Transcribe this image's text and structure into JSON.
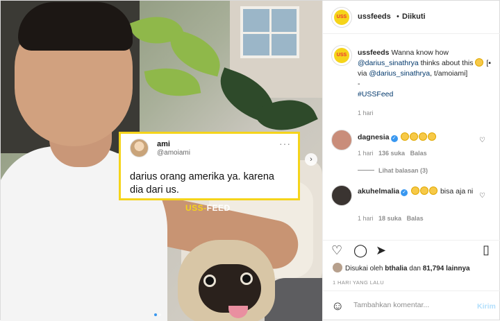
{
  "post": {
    "tweet": {
      "name": "ami",
      "handle": "@amoiami",
      "text": "darius orang amerika ya. karena dia dari us."
    },
    "watermark": {
      "part1": "USS-",
      "part2": "FEED"
    }
  },
  "header": {
    "username": "ussfeeds",
    "separator": "•",
    "follow_status": "Diikuti"
  },
  "caption": {
    "username": "ussfeeds",
    "text_1": "Wanna know how",
    "mention_1": "@darius_sinathrya",
    "text_2": "thinks about this",
    "text_3": "[",
    "text_4": "via",
    "mention_2": "@darius_sinathrya",
    "text_5": ",",
    "text_6": "t/amoiami]",
    "dash": "-",
    "hashtag": "#USSFeed",
    "time": "1 hari"
  },
  "comments": [
    {
      "username": "dagnesia",
      "text": "",
      "time": "1 hari",
      "likes": "136 suka",
      "reply": "Balas",
      "view_replies": "Lihat balasan (3)"
    },
    {
      "username": "akuhelmalia",
      "text": "bisa aja ni",
      "time": "1 hari",
      "likes": "18 suka",
      "reply": "Balas"
    }
  ],
  "likes_line": {
    "prefix": "Disukai oleh",
    "user": "bthalia",
    "mid": "dan",
    "count": "81,794 lainnya"
  },
  "date": "1 HARI YANG LALU",
  "comment_box": {
    "placeholder": "Tambahkan komentar...",
    "post": "Kirim"
  },
  "logo_text": "USS FEED",
  "colors": {
    "accent": "#f5d41a",
    "link": "#00376b",
    "blue": "#3897f0"
  },
  "icons": [
    "heart-icon",
    "comment-icon",
    "share-icon",
    "bookmark-icon",
    "emoji-icon",
    "verified-icon",
    "more-icon",
    "chevron-right-icon"
  ]
}
